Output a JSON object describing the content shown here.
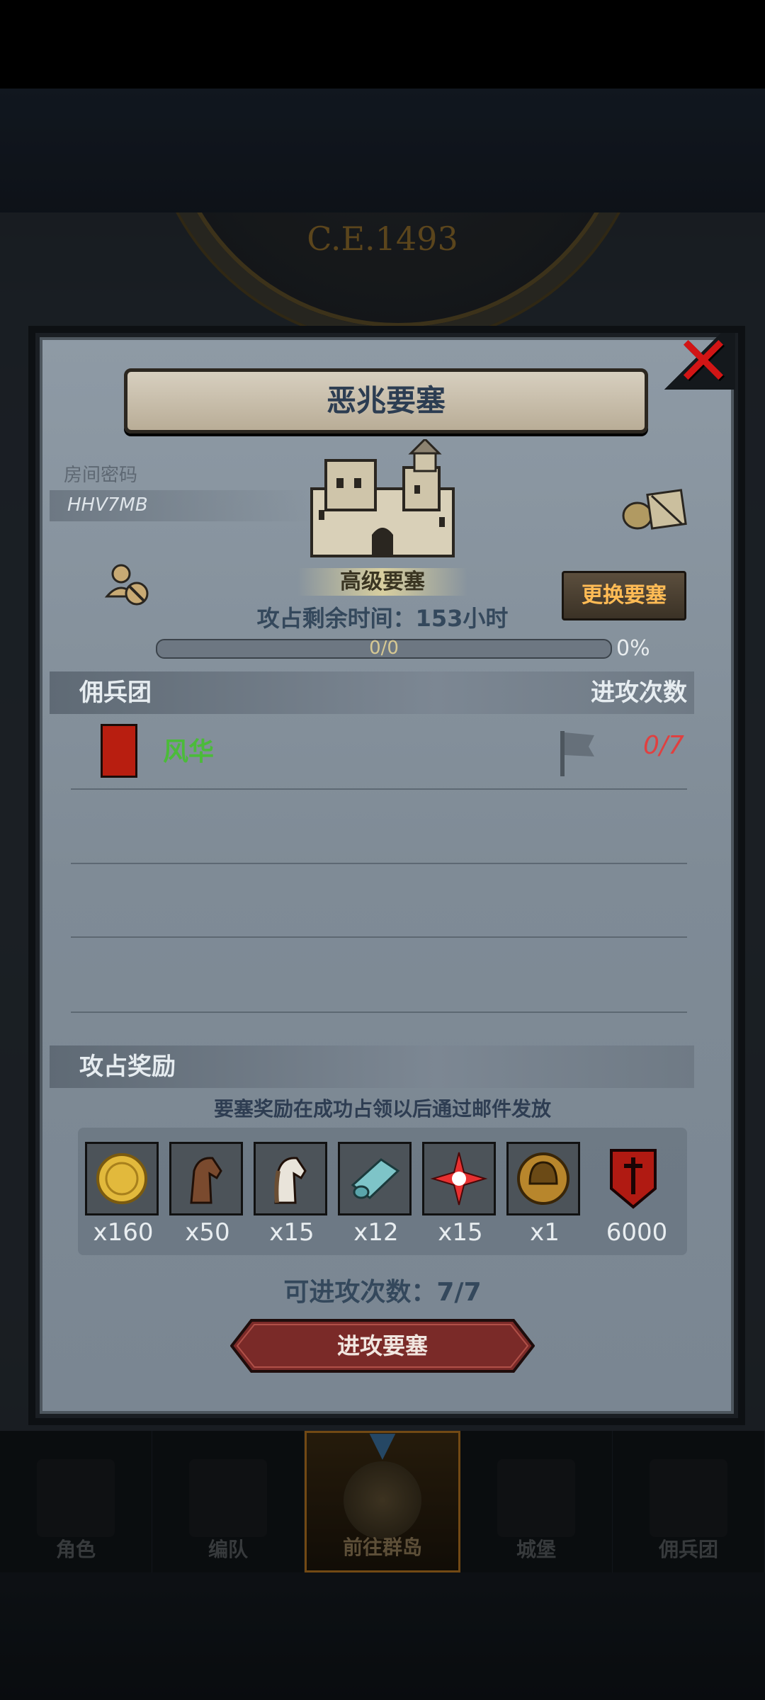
{
  "background": {
    "era_text": "C.E.1493"
  },
  "dialog": {
    "title": "恶兆要塞",
    "close_icon": "close-x-icon",
    "room": {
      "label": "房间密码",
      "code": "HHV7MB"
    },
    "fortress": {
      "type_label": "高级要塞",
      "change_button": "更换要塞",
      "time_remaining": "攻占剩余时间：153小时",
      "progress_text": "0/0",
      "progress_fraction": 0,
      "progress_percent": "0%"
    },
    "mercenary_section": {
      "title": "佣兵团",
      "right_header": "进攻次数",
      "rows": [
        {
          "name": "风华",
          "attacks": "0/7",
          "banner_icon": "red-banner-icon",
          "flag_icon": "flag-icon"
        }
      ]
    },
    "rewards_section": {
      "title": "攻占奖励",
      "note": "要塞奖励在成功占领以后通过邮件发放",
      "items": [
        {
          "icon": "gold-coin-icon",
          "qty": "x160"
        },
        {
          "icon": "brown-horse-icon",
          "qty": "x50"
        },
        {
          "icon": "white-horse-icon",
          "qty": "x15"
        },
        {
          "icon": "cloth-roll-icon",
          "qty": "x12"
        },
        {
          "icon": "red-star-icon",
          "qty": "x15"
        },
        {
          "icon": "helmet-medal-icon",
          "qty": "x1"
        },
        {
          "icon": "sword-banner-icon",
          "qty": "6000"
        }
      ]
    },
    "attack_count": "可进攻次数：7/7",
    "attack_button": "进攻要塞"
  },
  "bottom_nav": {
    "items": [
      {
        "label": "角色",
        "icon": "knight-icon",
        "active": false
      },
      {
        "label": "编队",
        "icon": "formation-icon",
        "active": false
      },
      {
        "label": "前往群岛",
        "icon": "globe-icon",
        "active": true
      },
      {
        "label": "城堡",
        "icon": "castle-icon",
        "active": false
      },
      {
        "label": "佣兵团",
        "icon": "ship-icon",
        "active": false
      }
    ]
  },
  "colors": {
    "accent_gold": "#ffbb55",
    "mercenary_green": "#4bbb3a",
    "attack_count_red": "#e04040",
    "close_red": "#d21515"
  }
}
